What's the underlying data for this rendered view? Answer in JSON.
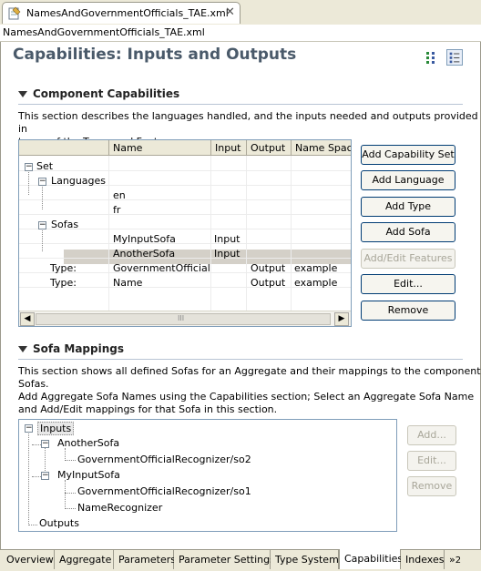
{
  "editor_tab": {
    "title": "NamesAndGovernmentOfficials_TAE.xml"
  },
  "subheader": "NamesAndGovernmentOfficials_TAE.xml",
  "page_title": "Capabilities: Inputs and Outputs",
  "component": {
    "section_title": "Component Capabilities",
    "description": [
      "This section describes the languages handled, and the inputs needed and outputs provided in",
      "terms of the Types and Features."
    ],
    "columns": [
      "Name",
      "Input",
      "Output",
      "Name Spac"
    ],
    "rows": [
      {
        "label": "Set",
        "name": "",
        "input": "",
        "output": "",
        "ns": ""
      },
      {
        "label": "Languages",
        "name": "",
        "input": "",
        "output": "",
        "ns": ""
      },
      {
        "label": "",
        "name": "en",
        "input": "",
        "output": "",
        "ns": ""
      },
      {
        "label": "",
        "name": "fr",
        "input": "",
        "output": "",
        "ns": ""
      },
      {
        "label": "Sofas",
        "name": "",
        "input": "",
        "output": "",
        "ns": ""
      },
      {
        "label": "",
        "name": "MyInputSofa",
        "input": "Input",
        "output": "",
        "ns": ""
      },
      {
        "label": "",
        "name": "AnotherSofa",
        "input": "Input",
        "output": "",
        "ns": ""
      },
      {
        "label": "Type:",
        "name": "GovernmentOfficial",
        "input": "",
        "output": "Output",
        "ns": "example"
      },
      {
        "label": "Type:",
        "name": "Name",
        "input": "",
        "output": "Output",
        "ns": "example"
      }
    ],
    "scroll_grip": "III",
    "buttons": {
      "add_capability_set": "Add Capability Set",
      "add_language": "Add Language",
      "add_type": "Add Type",
      "add_sofa": "Add Sofa",
      "add_edit_features": "Add/Edit Features",
      "edit": "Edit...",
      "remove": "Remove"
    }
  },
  "sofa": {
    "section_title": "Sofa Mappings",
    "description": [
      "This section shows all defined Sofas for an Aggregate and their mappings to the component",
      "Sofas.",
      "Add Aggregate Sofa Names using the Capabilities section; Select an Aggregate Sofa Name",
      "and Add/Edit mappings for that Sofa in this section."
    ],
    "tree": {
      "inputs": "Inputs",
      "another_sofa": "AnotherSofa",
      "another_sofa_map": "GovernmentOfficialRecognizer/so2",
      "my_input_sofa": "MyInputSofa",
      "my_input_sofa_map1": "GovernmentOfficialRecognizer/so1",
      "my_input_sofa_map2": "NameRecognizer",
      "outputs": "Outputs"
    },
    "buttons": {
      "add": "Add...",
      "edit": "Edit...",
      "remove": "Remove"
    }
  },
  "bottom_tabs": [
    "Overview",
    "Aggregate",
    "Parameters",
    "Parameter Settings",
    "Type System",
    "Capabilities",
    "Indexes"
  ],
  "bottom_tabs_active": "Capabilities",
  "overflow": "»",
  "overflow_count": "2",
  "colors": {
    "title": "#4a5a6a",
    "border": "#7f9db9",
    "button_border": "#003c74"
  }
}
